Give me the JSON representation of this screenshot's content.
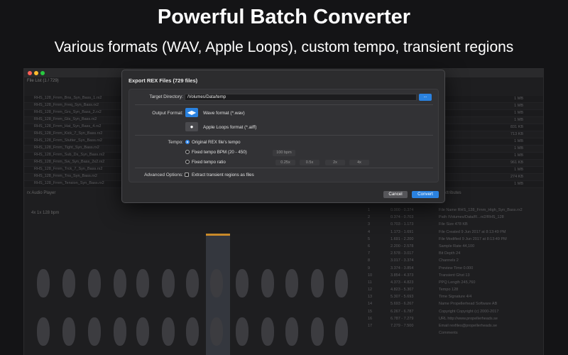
{
  "marketing": {
    "headline": "Powerful Batch Converter",
    "subhead": "Various formats (WAV, Apple Loops), custom tempo, transient regions"
  },
  "background_app": {
    "traffic_lights": {
      "close": "#ff5f57",
      "minimize": "#febc2e",
      "zoom": "#28c840"
    },
    "file_list_header": "File List (1 / 729)",
    "file_rows": [
      {
        "name": "RHS_128_Frnm_Bns_Syn_Bass_1.rx2",
        "size": "1 MB"
      },
      {
        "name": "RHS_128_Frnm_Freq_Syn_Bass.rx2",
        "size": "1 MB"
      },
      {
        "name": "RHS_128_Frnm_Grs_Syn_Bass_2.rx2",
        "size": "1 MB"
      },
      {
        "name": "RHS_128_Frnm_Gts_Syn_Bass.rx2",
        "size": "1 MB"
      },
      {
        "name": "RHS_128_Frnm_Hat_Syn_Bass_4.rx2",
        "size": "831 KB"
      },
      {
        "name": "RHS_128_Frnm_Kick_7_Syn_Bass.rx2",
        "size": "713 KB"
      },
      {
        "name": "RHS_128_Frnm_Stutter_Syn_Bass.rx2",
        "size": "1 MB"
      },
      {
        "name": "RHS_128_Frnm_Tight_Syn_Bass.rx2",
        "size": "1 MB"
      },
      {
        "name": "RHS_128_Frnm_Sub_Ds_Syn_Bass.rx2",
        "size": "1 MB"
      },
      {
        "name": "RHS_128_Frnm_Sw_Syn_Bass_2x2.rx2",
        "size": "961 KB"
      },
      {
        "name": "RHS_128_Frnm_Trck_7_Syn_Bass.rx2",
        "size": "1 MB"
      },
      {
        "name": "RHS_128_Frnm_Tns_Syn_Bass.rx2",
        "size": "274 KB"
      },
      {
        "name": "RHS_128_Frnm_Tension_Syn_Bass.rx2",
        "size": "1 MB"
      }
    ],
    "audio_player_label": "rx Audio Player",
    "transport_readout": "4x      1x      128 bpm",
    "attributes_label": "rx Attributes",
    "slice_times": [
      "0.000 - 0.374",
      "0.374 - 0.703",
      "0.703 - 1.173",
      "1.173 - 1.691",
      "1.691 - 2.200",
      "2.200 - 2.578",
      "2.578 - 3.017",
      "3.017 - 3.374",
      "3.374 - 3.854",
      "3.854 - 4.373",
      "4.373 - 4.823",
      "4.823 - 5.307",
      "5.307 - 5.693",
      "5.693 - 6.267",
      "6.267 - 6.787",
      "6.787 - 7.279",
      "7.279 - 7.500"
    ],
    "slice_numbers": [
      "1",
      "2",
      "3",
      "4",
      "5",
      "6",
      "7",
      "8",
      "9",
      "10",
      "11",
      "12",
      "13",
      "14",
      "15",
      "16",
      "17"
    ],
    "info_rows": [
      "File Name       RHS_128_Frnm_High_Syn_Bass.rx2",
      "Path            /Volumes/Data/R...rx2/RHS_128",
      "File Size       478 KB",
      "File Created    9 Jun 2017 at 8:13:49 PM",
      "File Modified   9 Jun 2017 at 8:13:49 PM",
      "Sample Rate     44,100",
      "Bit Depth       24",
      "Channels        2",
      "Preview Time    0.000",
      "Transient Ghst  13",
      "PPQ Length      245,760",
      "Tempo           128",
      "Time Signature  4/4",
      "Name            Propellerhead Software AB",
      "Copyright       Copyright (c) 2000-2017",
      "URL             http://www.propellerheads.se",
      "Email           rexfiles@propellerheads.se",
      "Comments"
    ]
  },
  "dialog": {
    "title": "Export REX Files (729 files)",
    "target_directory": {
      "label": "Target Directory:",
      "value": "/Volumes/Data/temp",
      "browse_label": "..."
    },
    "output_format": {
      "label": "Output Format:",
      "options": [
        {
          "label": "Wave format (*.wav)",
          "icon": "waveform-icon",
          "selected": true
        },
        {
          "label": "Apple Loops format (*.aiff)",
          "icon": "apple-icon",
          "selected": false
        }
      ]
    },
    "tempo": {
      "label": "Tempo:",
      "options": [
        {
          "label": "Original REX file's tempo",
          "selected": true
        },
        {
          "label": "Fixed tempo BPM (20 - 450)",
          "selected": false
        },
        {
          "label": "Fixed tempo ratio",
          "selected": false
        }
      ],
      "bpm_value": "100  bpm",
      "ratios": [
        "0.25x",
        "0.5x",
        "2x",
        "4x"
      ]
    },
    "advanced": {
      "label": "Advanced Options:",
      "checkbox_label": "Extract transient regions as files",
      "checked": false
    },
    "cancel_label": "Cancel",
    "convert_label": "Convert",
    "accent_color": "#2a82e0"
  }
}
